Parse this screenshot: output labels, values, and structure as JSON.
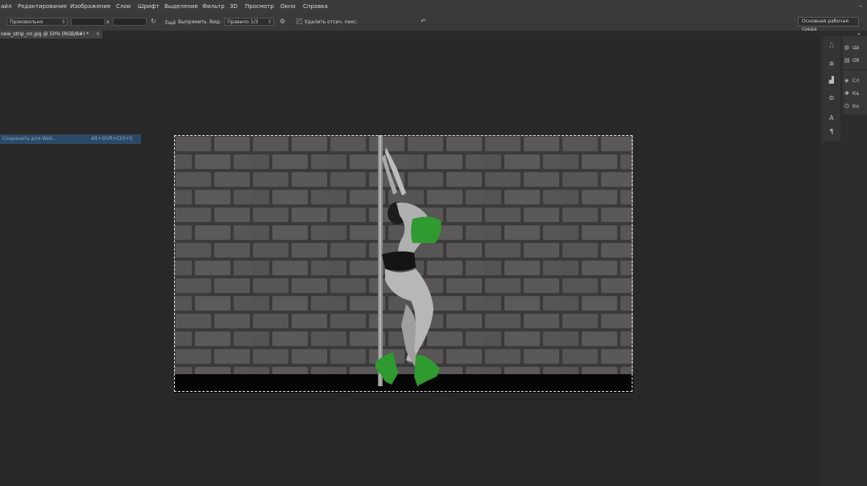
{
  "menu": {
    "items": [
      "айл",
      "Редактирование",
      "Изображение",
      "Слои",
      "Шрифт",
      "Выделение",
      "Фильтр",
      "3D",
      "Просмотр",
      "Окно",
      "Справка"
    ]
  },
  "window_controls": {
    "minimize": "–"
  },
  "options_bar": {
    "ratio_select": "Произвольно",
    "swap_symbol": "x",
    "clear_label": "Ещё",
    "straighten_label": "Выпрямить",
    "view_label": "Вид:",
    "view_select": "Правило 1/3",
    "delete_cropped_checked": true,
    "delete_cropped_label": "Удалить отсеч. пикс.",
    "workspace_select": "Основная рабочая среда"
  },
  "document_tab": {
    "title": "new_strip_nn.jpg @ 50% (RGB/8#) *",
    "close": "×"
  },
  "context_menu_item": {
    "label": "Сохранить для Web...",
    "shortcut": "Alt+Shift+Ctrl+S"
  },
  "right_panel": {
    "collapse_symbol": "«",
    "items": [
      {
        "icon": "color-icon",
        "label": "Цв"
      },
      {
        "icon": "swatches-icon",
        "label": "Об"
      },
      {
        "icon": "layers-icon",
        "label": "Сл"
      },
      {
        "icon": "channels-icon",
        "label": "Ка"
      },
      {
        "icon": "paths-icon",
        "label": "Ко"
      }
    ]
  },
  "colors": {
    "accent_green": "#2f9a2f",
    "selection_blue": "#2c4a66"
  }
}
